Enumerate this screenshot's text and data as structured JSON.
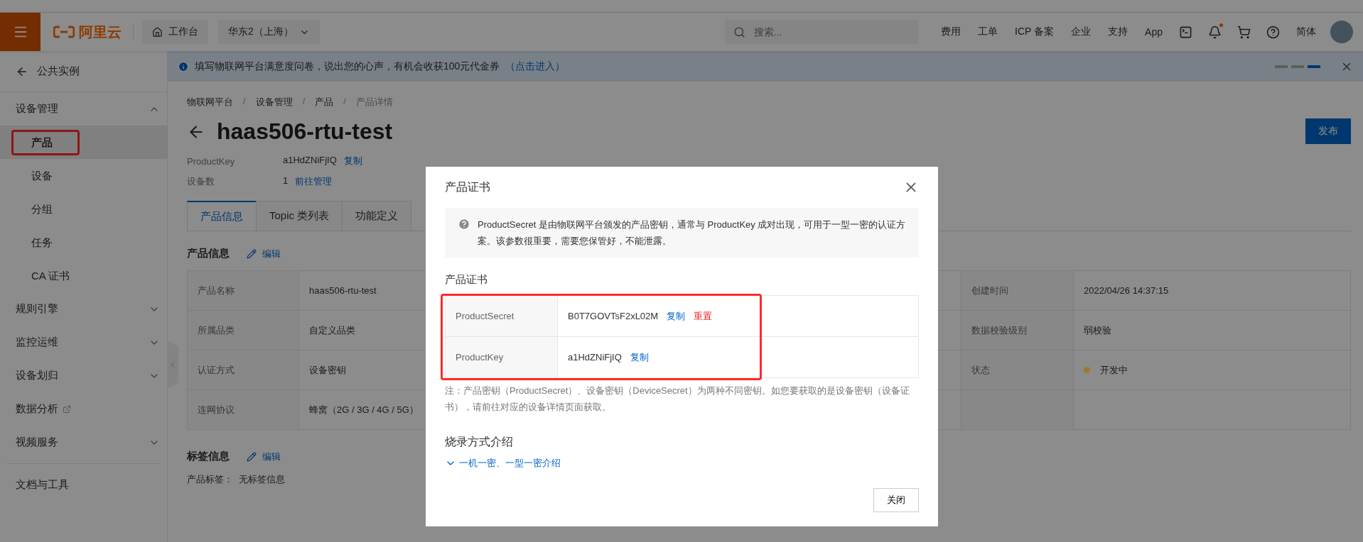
{
  "topbar": {
    "logo": "阿里云",
    "workbench": "工作台",
    "region": "华东2（上海）",
    "search": {
      "placeholder": "搜索..."
    },
    "links": [
      "费用",
      "工单",
      "ICP 备案",
      "企业",
      "支持",
      "App"
    ],
    "notification_dot": true,
    "language": "简体"
  },
  "sidebar": {
    "back": "公共实例",
    "groups": [
      {
        "label": "设备管理",
        "kind": "group",
        "expanded": true,
        "children": [
          {
            "label": "产品",
            "selected": true,
            "highlighted": true
          },
          {
            "label": "设备",
            "selected": false,
            "highlighted": false
          },
          {
            "label": "分组",
            "selected": false,
            "highlighted": false
          },
          {
            "label": "任务",
            "selected": false,
            "highlighted": false
          },
          {
            "label": "CA 证书",
            "selected": false,
            "highlighted": false
          }
        ]
      },
      {
        "label": "规则引擎",
        "kind": "group",
        "expanded": false
      },
      {
        "label": "监控运维",
        "kind": "group",
        "expanded": false
      },
      {
        "label": "设备划归",
        "kind": "group",
        "expanded": false
      },
      {
        "label": "数据分析",
        "kind": "external"
      },
      {
        "label": "视频服务",
        "kind": "group",
        "expanded": false
      },
      {
        "label": "文档与工具",
        "kind": "footer"
      }
    ]
  },
  "banner": {
    "text": "填写物联网平台满意度问卷，说出您的心声，有机会收获100元代金券",
    "link": "（点击进入）",
    "pages": [
      {
        "selected": false
      },
      {
        "selected": false
      },
      {
        "selected": true
      }
    ]
  },
  "breadcrumb": {
    "separator": "/",
    "items": [
      "物联网平台",
      "设备管理",
      "产品",
      "产品详情"
    ]
  },
  "title": "haas506-rtu-test",
  "publish_button": "发布",
  "meta": [
    {
      "label": "ProductKey",
      "value": "a1HdZNiFjIQ",
      "action": "复制"
    },
    {
      "label": "设备数",
      "value": "1",
      "action": "前往管理"
    }
  ],
  "tabs": [
    {
      "label": "产品信息",
      "selected": true
    },
    {
      "label": "Topic 类列表",
      "selected": false
    },
    {
      "label": "功能定义",
      "selected": false
    }
  ],
  "info_section": {
    "heading": "产品信息",
    "edit": "编辑",
    "rows": [
      {
        "label": "产品名称",
        "value": "haas506-rtu-test",
        "label_3": "创建时间",
        "value_3": "2022/04/26 14:37:15"
      },
      {
        "label": "所属品类",
        "value": "自定义品类",
        "label_3": "数据校验级别",
        "value_3": "弱校验"
      },
      {
        "label": "认证方式",
        "value": "设备密钥",
        "label_3": "状态",
        "value_3": "开发中",
        "color": "#9c7a2c"
      },
      {
        "label": "连网协议",
        "value": "蜂窝（2G / 3G / 4G / 5G）"
      }
    ]
  },
  "tag_section": {
    "heading": "标签信息",
    "edit": "编辑",
    "label": "产品标签：",
    "value": "无标签信息"
  },
  "dialog": {
    "title": "产品证书",
    "info": "ProductSecret 是由物联网平台颁发的产品密钥，通常与 ProductKey 成对出现，可用于一型一密的认证方案。该参数很重要，需要您保管好，不能泄露。",
    "heading": "产品证书",
    "highlighted": true,
    "rows": [
      {
        "label": "ProductSecret",
        "value": "B0T7GOVTsF2xL02M",
        "actions": [
          {
            "label": "复制",
            "kind": "link"
          },
          {
            "label": "重置",
            "kind": "danger"
          }
        ]
      },
      {
        "label": "ProductKey",
        "value": "a1HdZNiFjIQ",
        "actions": [
          {
            "label": "复制",
            "kind": "link"
          }
        ]
      }
    ],
    "note": "注：产品密钥（ProductSecret）、设备密钥（DeviceSecret）为两种不同密钥。如您要获取的是设备密钥（设备证书），请前往对应的设备详情页面获取。",
    "burn_heading": "烧录方式介绍",
    "burn_link": "一机一密、一型一密介绍",
    "close_button": "关闭"
  }
}
